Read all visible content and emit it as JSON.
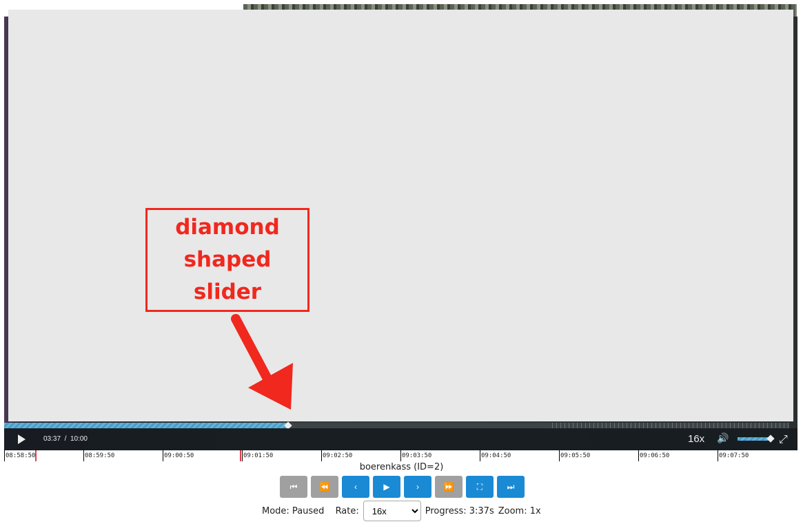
{
  "player": {
    "current_time": "03:37",
    "separator": "/",
    "duration": "10:00",
    "progress_fraction": 0.362,
    "rate_label": "16x",
    "volume_fraction": 0.95,
    "accent_color": "#5fb4dc"
  },
  "timeline": {
    "ticks": [
      "08:58:50",
      "08:59:50",
      "09:00:50",
      "09:01:50",
      "09:02:50",
      "09:03:50",
      "09:04:50",
      "09:05:50",
      "09:06:50",
      "09:07:50"
    ],
    "marker_color": "#e04050"
  },
  "stream_title": "boerenkass (ID=2)",
  "buttons": [
    {
      "name": "first",
      "icon": "skip-start-icon",
      "glyph": "⏮",
      "enabled": false
    },
    {
      "name": "rewind",
      "icon": "rewind-icon",
      "glyph": "⏪",
      "enabled": false
    },
    {
      "name": "step-back",
      "icon": "chevron-left-icon",
      "glyph": "‹",
      "enabled": true
    },
    {
      "name": "play",
      "icon": "play-icon",
      "glyph": "▶",
      "enabled": true
    },
    {
      "name": "step-forward",
      "icon": "chevron-right-icon",
      "glyph": "›",
      "enabled": true
    },
    {
      "name": "fast-forward",
      "icon": "fast-forward-icon",
      "glyph": "⏩",
      "enabled": false
    },
    {
      "name": "fullscreen",
      "icon": "fullscreen-icon",
      "glyph": "⛶",
      "enabled": true
    },
    {
      "name": "last",
      "icon": "skip-end-icon",
      "glyph": "⏭",
      "enabled": true
    }
  ],
  "status": {
    "mode_label": "Mode: Paused",
    "rate_label": "Rate:",
    "rate_value": "16x",
    "progress_label": "Progress: 3:37s",
    "zoom_label": "Zoom: 1x"
  },
  "annotation": {
    "text": "diamond shaped slider",
    "color": "#f0281e"
  }
}
